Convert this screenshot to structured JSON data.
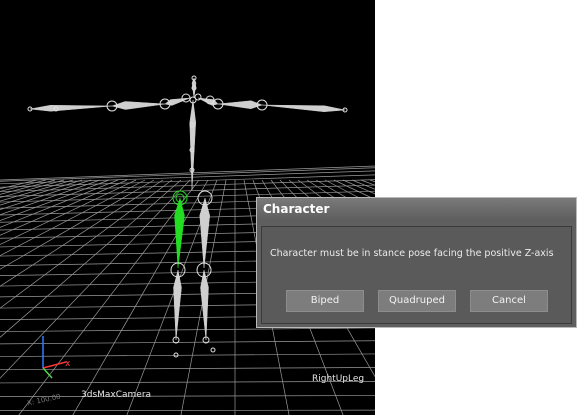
{
  "viewport": {
    "camera_label": "3dsMaxCamera",
    "selected_bone_label": "RightUpLeg",
    "gizmo": {
      "x_label": "x",
      "scale_text": "X: 100.00"
    }
  },
  "dialog": {
    "title": "Character",
    "message": "Character must be in stance pose facing the positive Z-axis",
    "buttons": {
      "biped": "Biped",
      "quadruped": "Quadruped",
      "cancel": "Cancel"
    }
  },
  "colors": {
    "viewport_bg": "#000000",
    "grid": "#9a9a9a",
    "bone": "#d0d0d0",
    "selected_bone": "#22dd22",
    "dialog_bg": "#5f5f5f",
    "button_bg": "#7d7d7d"
  }
}
